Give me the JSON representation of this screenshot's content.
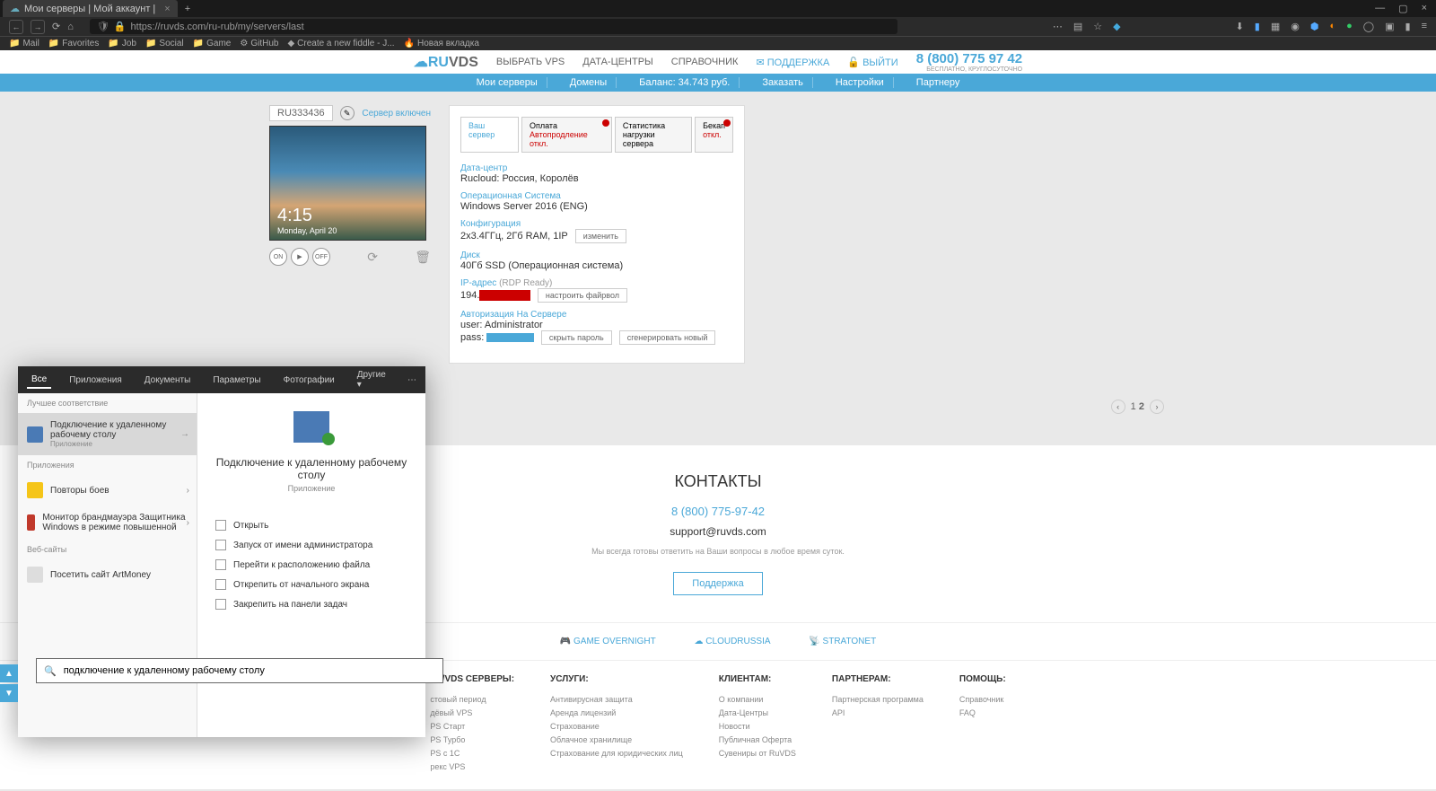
{
  "browser": {
    "tab_title": "Мои серверы | Мой аккаунт |",
    "url": "https://ruvds.com/ru-rub/my/servers/last",
    "bookmarks": [
      "Mail",
      "Favorites",
      "Job",
      "Social",
      "Game",
      "GitHub",
      "Create a new fiddle - J...",
      "Новая вкладка"
    ]
  },
  "header": {
    "logo1": "RU",
    "logo2": "VDS",
    "nav": [
      "ВЫБРАТЬ VPS",
      "ДАТА-ЦЕНТРЫ",
      "СПРАВОЧНИК"
    ],
    "support": "ПОДДЕРЖКА",
    "logout": "ВЫЙТИ",
    "phone": "8 (800) 775 97 42",
    "phone_sub": "БЕСПЛАТНО, КРУГЛОСУТОЧНО"
  },
  "subnav": {
    "items": [
      "Мои серверы",
      "Домены",
      "Баланс: 34.743 руб.",
      "Заказать",
      "Настройки",
      "Партнеру"
    ]
  },
  "server": {
    "id": "RU333436",
    "status": "Сервер включен",
    "time": "4:15",
    "date": "Monday, April 20",
    "ctrl_on": "ON",
    "ctrl_play": "▶",
    "ctrl_off": "OFF"
  },
  "panel": {
    "tabs": {
      "t1": "Ваш сервер",
      "t2a": "Оплата",
      "t2b": "Автопродление откл.",
      "t3a": "Статистика",
      "t3b": "нагрузки сервера",
      "t4a": "Бекап",
      "t4b": "откл."
    },
    "dc_label": "Дата-центр",
    "dc_val": "Rucloud: Россия, Королёв",
    "os_label": "Операционная Система",
    "os_val": "Windows Server 2016 (ENG)",
    "conf_label": "Конфигурация",
    "conf_val": "2x3.4ГГц, 2Гб RAM, 1IP",
    "conf_btn": "изменить",
    "disk_label": "Диск",
    "disk_val": "40Гб SSD (Операционная система)",
    "ip_label": "IP-адрес",
    "ip_ready": "(RDP Ready)",
    "ip_val": "194.",
    "fw_btn": "настроить файрвол",
    "auth_label": "Авторизация На Сервере",
    "user_label": "user:",
    "user_val": "Administrator",
    "pass_label": "pass:",
    "hide_btn": "скрыть пароль",
    "gen_btn": "сгенерировать новый"
  },
  "pagination": {
    "p1": "1",
    "p2": "2"
  },
  "contacts": {
    "title": "КОНТАКТЫ",
    "phone": "8 (800) 775-97-42",
    "email": "support@ruvds.com",
    "note": "Мы всегда готовы ответить на Ваши вопросы в любое время суток.",
    "btn": "Поддержка"
  },
  "partners": {
    "p1": "GAME OVERNIGHT",
    "p2": "CLOUDRUSSIA",
    "p3": "STRATONET"
  },
  "footer": {
    "c1h": "PS/VDS СЕРВЕРЫ:",
    "c1": [
      "стовый период",
      "дёвый VPS",
      "PS Старт",
      "PS Турбо",
      "PS с 1С",
      "рекс VPS"
    ],
    "c2h": "УСЛУГИ:",
    "c2": [
      "Антивирусная защита",
      "Аренда лицензий",
      "Страхование",
      "Облачное хранилище",
      "Страхование для юридических лиц"
    ],
    "c3h": "КЛИЕНТАМ:",
    "c3": [
      "О компании",
      "Дата-Центры",
      "Новости",
      "Публичная Оферта",
      "Сувениры от RuVDS"
    ],
    "c4h": "ПАРТНЕРАМ:",
    "c4": [
      "Партнерская программа",
      "API"
    ],
    "c5h": "ПОМОЩЬ:",
    "c5": [
      "Справочник",
      "FAQ"
    ]
  },
  "winsearch": {
    "tabs": [
      "Все",
      "Приложения",
      "Документы",
      "Параметры",
      "Фотографии",
      "Другие ▾"
    ],
    "sec1": "Лучшее соответствие",
    "item1_title": "Подключение к удаленному рабочему столу",
    "item1_sub": "Приложение",
    "sec2": "Приложения",
    "item2": "Повторы боев",
    "item3": "Монитор брандмауэра Защитника Windows в режиме повышенной",
    "sec3": "Веб-сайты",
    "item4": "Посетить сайт ArtMoney",
    "right_title": "Подключение к удаленному рабочему столу",
    "right_type": "Приложение",
    "actions": [
      "Открыть",
      "Запуск от имени администратора",
      "Перейти к расположению файла",
      "Открепить от начального экрана",
      "Закрепить на панели задач"
    ],
    "search_text": "подключение к удаленному рабочему столу"
  }
}
